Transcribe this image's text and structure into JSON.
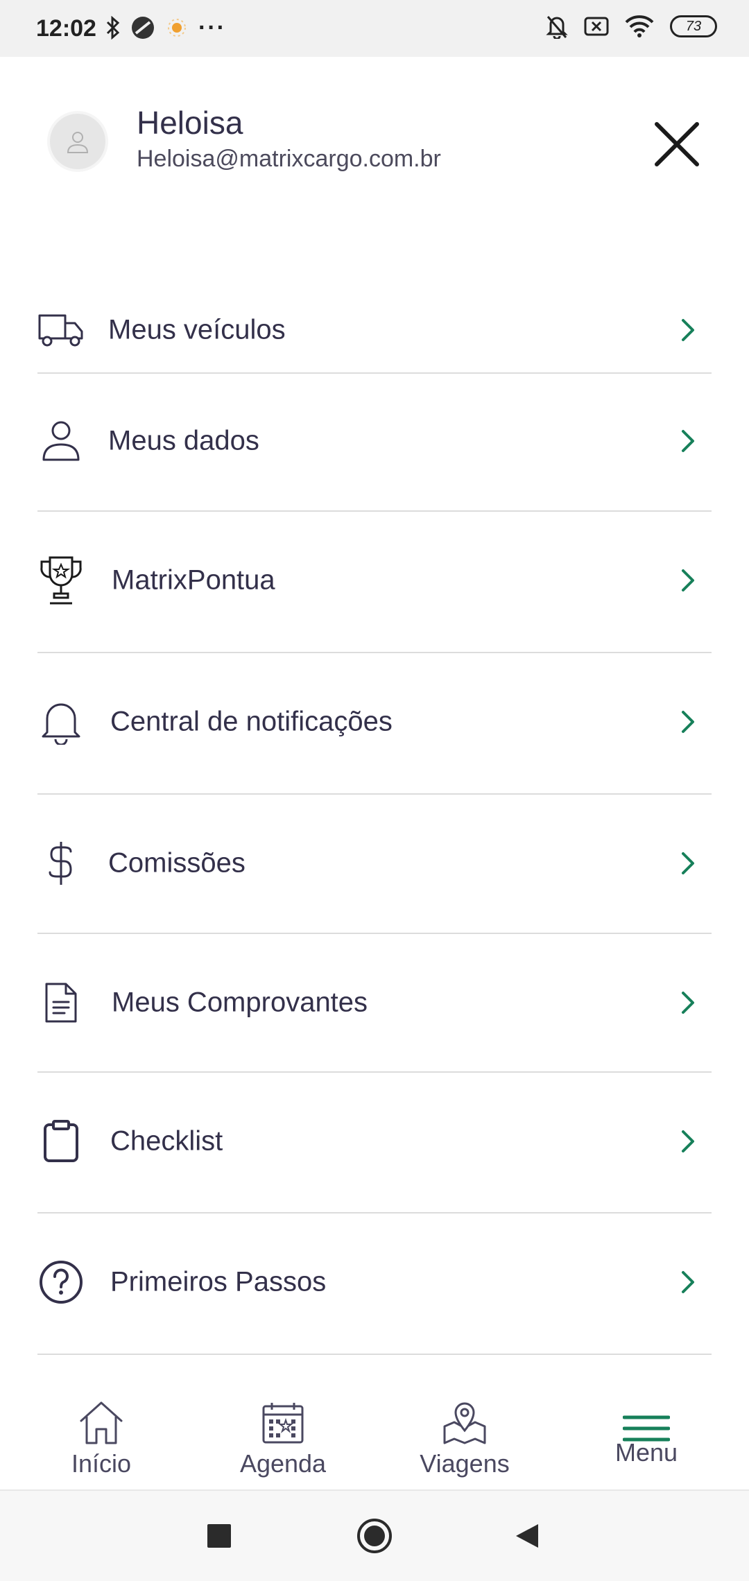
{
  "status_bar": {
    "time": "12:02",
    "battery": "73",
    "icons_left": [
      "bluetooth-icon",
      "app-icon",
      "sun-icon",
      "more-dots-icon"
    ],
    "icons_right": [
      "bell-off-icon",
      "sim-off-icon",
      "wifi-icon",
      "battery-icon"
    ],
    "more": "···"
  },
  "header": {
    "user_name": "Heloisa",
    "user_email": "Heloisa@matrixcargo.com.br"
  },
  "menu": {
    "items": [
      {
        "label": "Meus veículos",
        "icon": "truck-icon"
      },
      {
        "label": "Meus dados",
        "icon": "user-icon"
      },
      {
        "label": "MatrixPontua",
        "icon": "trophy-icon"
      },
      {
        "label": "Central de notificações",
        "icon": "bell-icon"
      },
      {
        "label": "Comissões",
        "icon": "dollar-icon"
      },
      {
        "label": "Meus Comprovantes",
        "icon": "document-icon"
      },
      {
        "label": "Checklist",
        "icon": "clipboard-icon"
      },
      {
        "label": "Primeiros Passos",
        "icon": "help-circle-icon"
      }
    ]
  },
  "tabbar": {
    "tabs": [
      {
        "label": "Início",
        "icon": "home-icon"
      },
      {
        "label": "Agenda",
        "icon": "calendar-icon"
      },
      {
        "label": "Viagens",
        "icon": "map-pin-icon"
      },
      {
        "label": "Menu",
        "icon": "hamburger-icon",
        "active": true
      }
    ]
  },
  "colors": {
    "accent": "#17805a",
    "text": "#33304a",
    "divider": "#dcdcdc"
  }
}
